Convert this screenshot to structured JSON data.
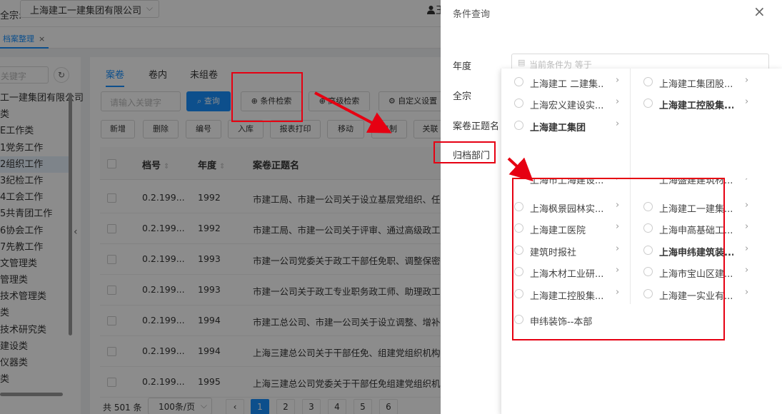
{
  "topbar": {
    "qz_label": "全宗:",
    "qz_value": "上海建工一建集团有限公司",
    "user_icon": "user-icon",
    "user_name": "王"
  },
  "tabbar": {
    "tab_label": "档案整理",
    "close": "×"
  },
  "sidebar": {
    "keyword_placeholder": "关键字",
    "refresh_icon": "↻",
    "collapse_icon": "‹",
    "items": [
      "工一建集团有限公司",
      "类",
      "E工作类",
      "1党务工作",
      "2组织工作",
      "3纪检工作",
      "4工会工作",
      "5共青团工作",
      "6协会工作",
      "7先教工作",
      "文管理类",
      "管理类",
      "技术管理类",
      "类",
      "技术研究类",
      "建设类",
      "仪器类",
      "类"
    ]
  },
  "main": {
    "tabs": [
      "案卷",
      "卷内",
      "未组卷"
    ],
    "search_placeholder": "请输入关键字",
    "query_btn": "查询",
    "cond_search_btn": "条件检索",
    "adv_search_btn": "高级检索",
    "custom_btn": "自定义设置",
    "actions": [
      "新增",
      "删除",
      "编号",
      "入库",
      "报表打印",
      "移动",
      "复制",
      "关联"
    ],
    "columns": [
      "档号",
      "年度",
      "案卷正题名"
    ],
    "rows": [
      {
        "code": "0.2.199...",
        "year": "1992",
        "title": "市建工局、市建一公司关于设立基层党组织、任"
      },
      {
        "code": "0.2.199...",
        "year": "1992",
        "title": "市建工局、市建一公司关于评审、通过高级政工"
      },
      {
        "code": "0.2.199...",
        "year": "1993",
        "title": "市建一公司党委关于政工干部任免职、调整保密"
      },
      {
        "code": "0.2.199...",
        "year": "1993",
        "title": "市建一公司关于政工专业职务政工师、助理政工"
      },
      {
        "code": "0.2.199...",
        "year": "1994",
        "title": "市建工总公司、市建一公司关于设立调整、增补"
      },
      {
        "code": "0.2.199...",
        "year": "1994",
        "title": "上海三建总公司关于干部任免、组建党组织机构"
      },
      {
        "code": "0.2.199...",
        "year": "1995",
        "title": "上海三建总公司党委关于干部任免组建党组织机"
      }
    ],
    "pager": {
      "total": "共 501 条",
      "size": "100条/页",
      "prev": "‹",
      "pages": [
        "1",
        "2",
        "3",
        "4",
        "5",
        "6"
      ]
    }
  },
  "drawer": {
    "title": "条件查询",
    "close": "×",
    "labels": [
      "年度",
      "全宗",
      "案卷正题名",
      "归档部门"
    ],
    "year_placeholder": "当前条件为 等于",
    "calendar_icon": "calendar-icon",
    "cascader": {
      "left": [
        {
          "label": "上海建工 二建集...",
          "bold": false
        },
        {
          "label": "上海宏义建设实...",
          "bold": false
        },
        {
          "label": "上海建工集团",
          "bold": true
        },
        {
          "label": "上海市上海建设...",
          "bold": false
        },
        {
          "label": "上海枫景园林实...",
          "bold": false
        },
        {
          "label": "上海建工医院",
          "bold": false
        },
        {
          "label": "建筑时报社",
          "bold": false
        },
        {
          "label": "上海木材工业研...",
          "bold": false
        },
        {
          "label": "上海建工控股集...",
          "bold": false
        },
        {
          "label": "申纬装饰--本部",
          "bold": false
        }
      ],
      "right": [
        {
          "label": "上海建工集团股...",
          "bold": false
        },
        {
          "label": "上海建工控股集...",
          "bold": true
        },
        {
          "label": "上海盛建建筑材...",
          "bold": false
        },
        {
          "label": "上海建工一建集...",
          "bold": false
        },
        {
          "label": "上海申高基础工...",
          "bold": false
        },
        {
          "label": "上海申纬建筑装...",
          "bold": true
        },
        {
          "label": "上海市宝山区建...",
          "bold": false
        },
        {
          "label": "上海建一实业有...",
          "bold": false
        }
      ],
      "arrow": "›"
    }
  }
}
